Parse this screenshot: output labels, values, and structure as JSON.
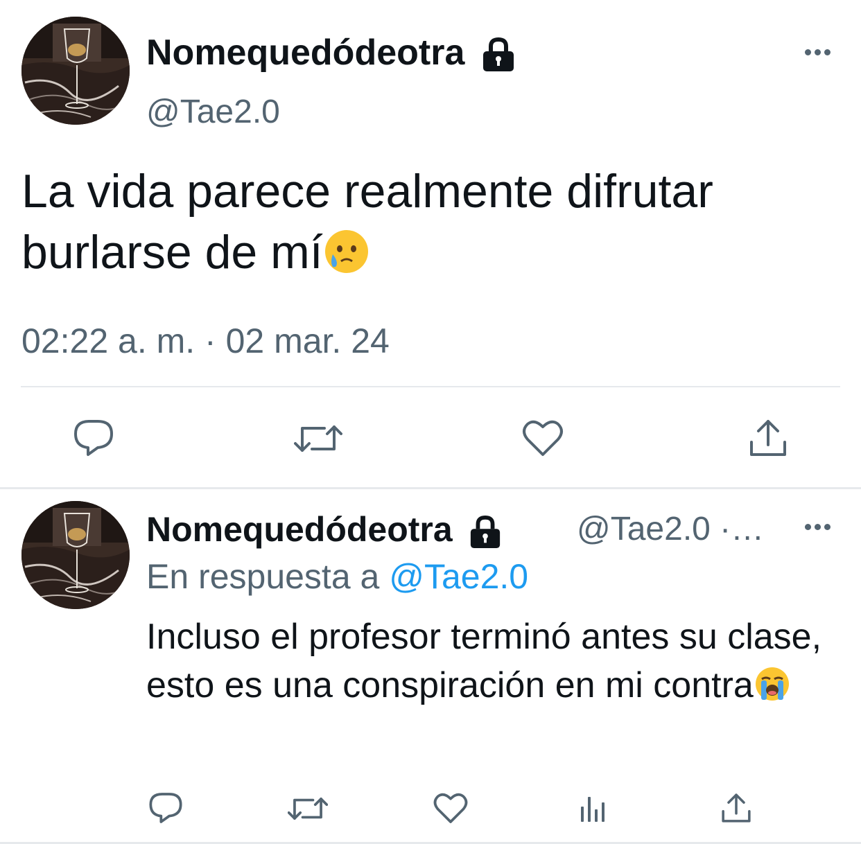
{
  "tweet": {
    "author_name": "Nomequedódeotra",
    "author_handle": "@Tae2.0",
    "text": "La vida parece realmente difrutar burlarse de mí",
    "text_emoji": "face-holding-back-tears",
    "timestamp": "02:22 a. m. · 02 mar. 24",
    "icons": {
      "lock": "lock-icon",
      "more": "more-options-icon",
      "actions": [
        "reply-icon",
        "retweet-icon",
        "like-icon",
        "share-icon"
      ]
    }
  },
  "reply": {
    "author_name": "Nomequedódeotra",
    "author_handle": "@Tae2.0 ·…",
    "reply_prefix": "En respuesta a",
    "reply_mention": "@Tae2.0",
    "text": "Incluso el profesor terminó antes su clase, esto es una conspiración en mi contra",
    "text_emoji": "loudly-crying-face",
    "icons": {
      "actions": [
        "reply-icon",
        "retweet-icon",
        "like-icon",
        "analytics-icon",
        "share-icon"
      ]
    }
  },
  "colors": {
    "text": "#0f1419",
    "secondary": "#536471",
    "link": "#1d9bf0",
    "divider": "#e6e9ec"
  }
}
